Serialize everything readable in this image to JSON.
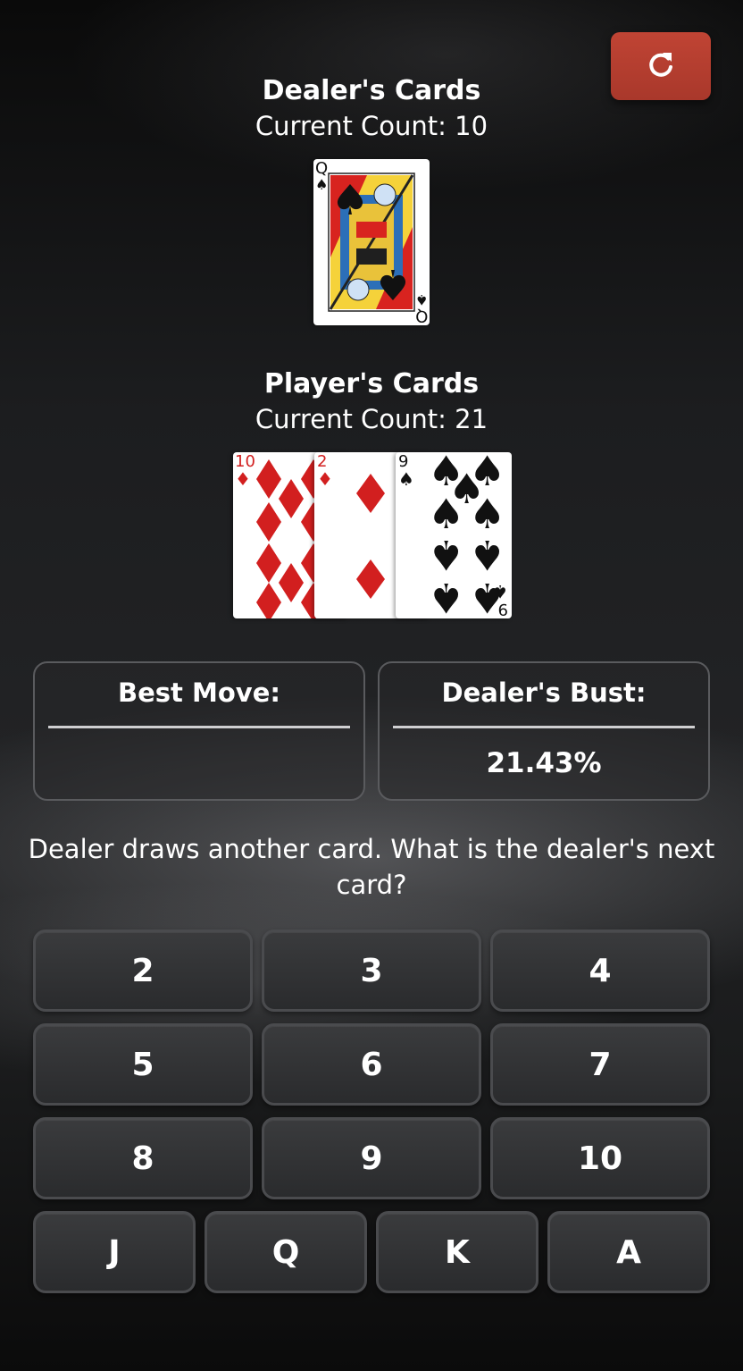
{
  "dealer": {
    "title": "Dealer's Cards",
    "count_label": "Current Count: 10",
    "cards": [
      {
        "rank": "Q",
        "suit": "spades"
      }
    ]
  },
  "player": {
    "title": "Player's Cards",
    "count_label": "Current Count: 21",
    "cards": [
      {
        "rank": "10",
        "suit": "diamonds"
      },
      {
        "rank": "2",
        "suit": "diamonds"
      },
      {
        "rank": "9",
        "suit": "spades"
      }
    ]
  },
  "best_move": {
    "label": "Best Move:",
    "value": ""
  },
  "dealer_bust": {
    "label": "Dealer's Bust:",
    "value": "21.43%"
  },
  "prompt": "Dealer draws another card. What is the dealer's next card?",
  "keypad": {
    "row1": [
      "2",
      "3",
      "4"
    ],
    "row2": [
      "5",
      "6",
      "7"
    ],
    "row3": [
      "8",
      "9",
      "10"
    ],
    "row4": [
      "J",
      "Q",
      "K",
      "A"
    ]
  },
  "icons": {
    "reset": "refresh-icon"
  },
  "colors": {
    "reset_button": "#b23d2f",
    "diamond_red": "#d21f1f",
    "spade_black": "#111111"
  }
}
